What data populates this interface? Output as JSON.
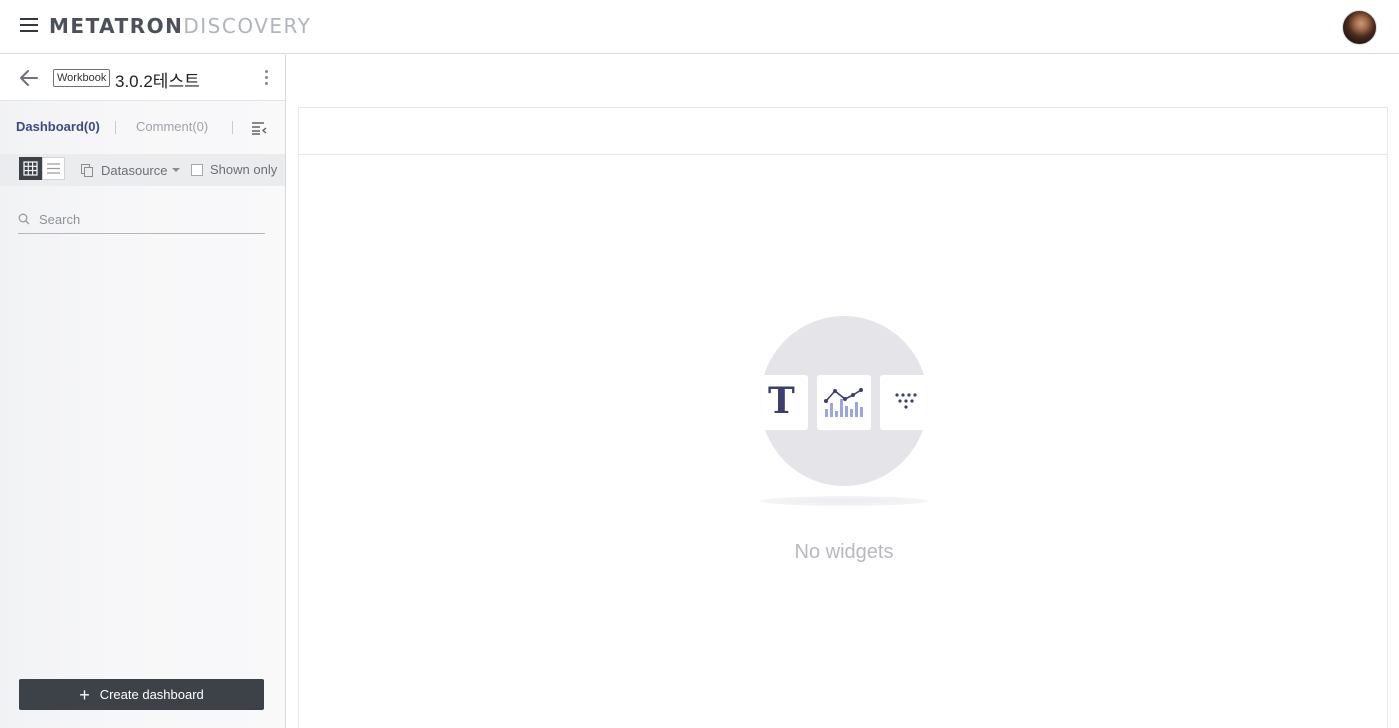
{
  "header": {
    "logo_primary": "METATRON",
    "logo_secondary": "DISCOVERY"
  },
  "workbook": {
    "badge": "Workbook",
    "title": "3.0.2테스트"
  },
  "tabs": {
    "dashboard": "Dashboard(0)",
    "comment": "Comment(0)"
  },
  "toolbar": {
    "datasource_label": "Datasource",
    "shown_only_label": "Shown only"
  },
  "search": {
    "placeholder": "Search"
  },
  "create_button": {
    "label": "Create dashboard"
  },
  "empty_state": {
    "message": "No widgets",
    "text_card_glyph": "T"
  },
  "colors": {
    "accent": "#3d4a8a",
    "dark_button": "#3d4148",
    "empty_circle": "#e4e4e9"
  },
  "icons": [
    "hamburger-icon",
    "back-arrow-icon",
    "more-vert-icon",
    "list-collapse-icon",
    "grid-view-icon",
    "list-view-icon",
    "datasource-icon",
    "search-icon",
    "plus-icon",
    "chart-icon",
    "filter-dots-icon"
  ]
}
